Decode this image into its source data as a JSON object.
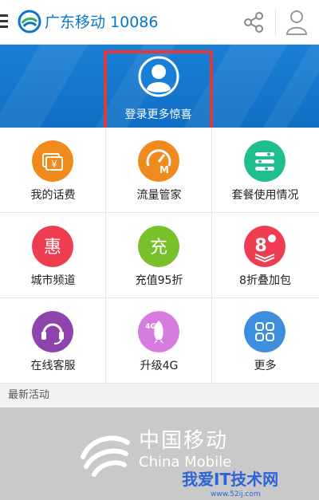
{
  "header": {
    "title": "广东移动 10086",
    "icons": {
      "menu": "menu-icon",
      "logo": "china-mobile-logo-icon",
      "share": "share-icon",
      "user": "user-icon"
    },
    "colors": {
      "title": "#0a76c9"
    }
  },
  "banner": {
    "login_text": "登录更多惊喜",
    "colors": {
      "background": "#1a7fd6",
      "highlight_border": "#e23a3a"
    }
  },
  "grid": {
    "items": [
      {
        "label": "我的话费",
        "icon": "bill-icon",
        "color": "#f08a1d",
        "glyph": "¥"
      },
      {
        "label": "流量管家",
        "icon": "data-meter-icon",
        "color": "#f08a1d",
        "glyph": "M"
      },
      {
        "label": "套餐使用情况",
        "icon": "plan-usage-icon",
        "color": "#1fbe8f",
        "glyph": ""
      },
      {
        "label": "城市频道",
        "icon": "city-channel-icon",
        "color": "#ee3d51",
        "glyph": "惠"
      },
      {
        "label": "充值95折",
        "icon": "recharge-icon",
        "color": "#79c12a",
        "glyph": "充"
      },
      {
        "label": "8折叠加包",
        "icon": "discount-pack-icon",
        "color": "#ee3d51",
        "glyph": "8"
      },
      {
        "label": "在线客服",
        "icon": "customer-service-icon",
        "color": "#8e44ad",
        "glyph": ""
      },
      {
        "label": "升级4G",
        "icon": "upgrade-4g-icon",
        "color": "#d77be0",
        "glyph": "4G"
      },
      {
        "label": "更多",
        "icon": "more-icon",
        "color": "#3c8ede",
        "glyph": ""
      }
    ]
  },
  "activities": {
    "title": "最新活动"
  },
  "promo": {
    "name_cn": "中国移动",
    "name_en": "China Mobile",
    "watermark": "我爱IT技术网",
    "watermark_sub": "www.52ij.com"
  }
}
